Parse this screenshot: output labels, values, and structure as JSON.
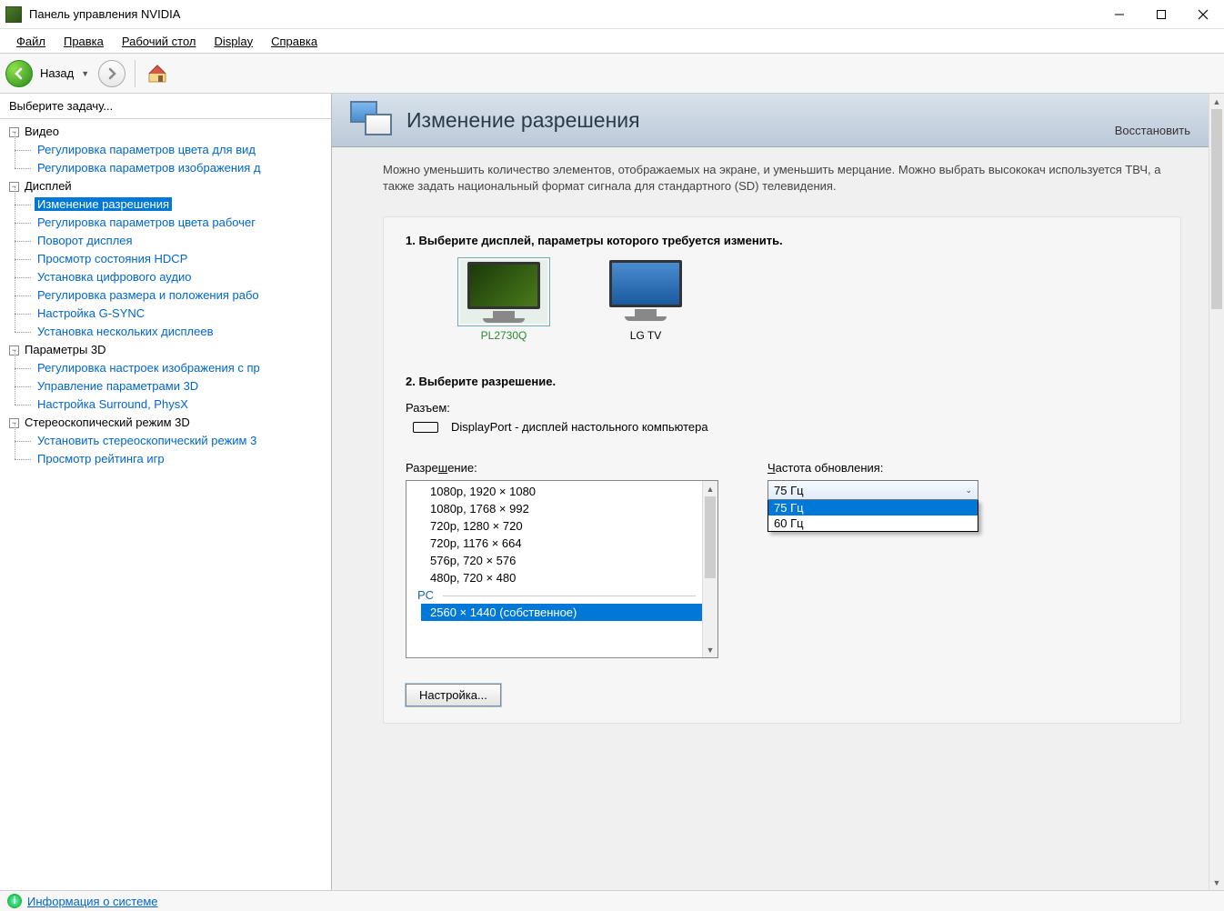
{
  "window": {
    "title": "Панель управления NVIDIA"
  },
  "menubar": {
    "file": "Файл",
    "edit": "Правка",
    "desktop": "Рабочий стол",
    "display": "Display",
    "help": "Справка"
  },
  "toolbar": {
    "back": "Назад"
  },
  "sidebar": {
    "header": "Выберите задачу...",
    "categories": [
      {
        "label": "Видео",
        "items": [
          "Регулировка параметров цвета для вид",
          "Регулировка параметров изображения д"
        ]
      },
      {
        "label": "Дисплей",
        "items": [
          "Изменение разрешения",
          "Регулировка параметров цвета рабочег",
          "Поворот дисплея",
          "Просмотр состояния HDCP",
          "Установка цифрового аудио",
          "Регулировка размера и положения рабо",
          "Настройка G-SYNC",
          "Установка нескольких дисплеев"
        ]
      },
      {
        "label": "Параметры 3D",
        "items": [
          "Регулировка настроек изображения с пр",
          "Управление параметрами 3D",
          "Настройка Surround, PhysX"
        ]
      },
      {
        "label": "Стереоскопический режим 3D",
        "items": [
          "Установить стереоскопический режим 3",
          "Просмотр рейтинга игр"
        ]
      }
    ],
    "selected": "Изменение разрешения"
  },
  "statusbar": {
    "info_link": "Информация о системе"
  },
  "page": {
    "title": "Изменение разрешения",
    "restore": "Восстановить",
    "description": "Можно уменьшить количество элементов, отображаемых на экране, и уменьшить мерцание. Можно выбрать высококач используется ТВЧ, а также задать национальный формат сигнала для стандартного (SD) телевидения.",
    "step1_title": "1. Выберите дисплей, параметры которого требуется изменить.",
    "displays": [
      {
        "name": "PL2730Q",
        "selected": true
      },
      {
        "name": "LG TV",
        "selected": false
      }
    ],
    "step2_title": "2. Выберите разрешение.",
    "connector_label": "Разъем:",
    "connector_value": "DisplayPort - дисплей настольного компьютера",
    "resolution_label": "Разрешение:",
    "resolutions": {
      "visible": [
        "1080p, 1920 × 1080",
        "1080p, 1768 × 992",
        "720p, 1280 × 720",
        "720p, 1176 × 664",
        "576p, 720 × 576",
        "480p, 720 × 480"
      ],
      "group_pc": "PC",
      "selected": "2560 × 1440 (собственное)"
    },
    "refresh_label": "Частота обновления:",
    "refresh_selected": "75 Гц",
    "refresh_options": [
      "75 Гц",
      "60 Гц"
    ],
    "configure_button": "Настройка..."
  }
}
